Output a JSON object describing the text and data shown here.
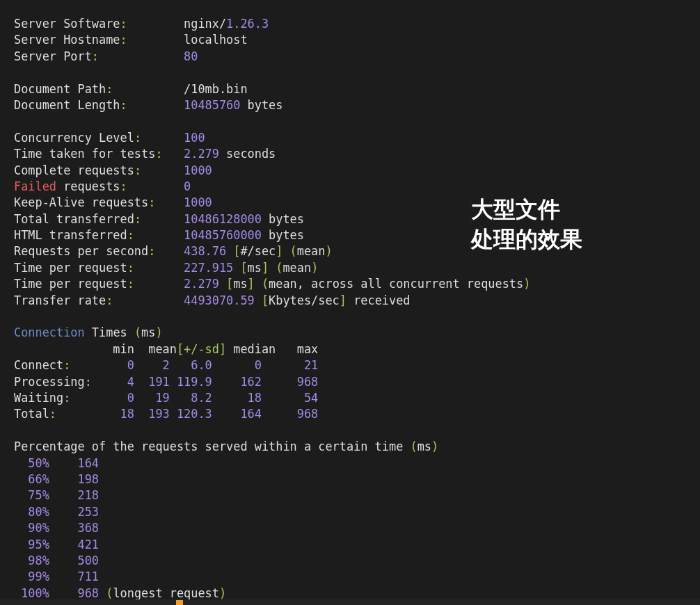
{
  "sections": [
    {
      "lines": [
        {
          "label": [
            {
              "text": "Server Software",
              "kind": "text"
            },
            {
              "text": ":",
              "kind": "punct"
            }
          ],
          "value": [
            {
              "text": "nginx/",
              "kind": "text"
            },
            {
              "text": "1.26.3",
              "kind": "number"
            }
          ]
        },
        {
          "label": [
            {
              "text": "Server Hostname",
              "kind": "text"
            },
            {
              "text": ":",
              "kind": "punct"
            }
          ],
          "value": [
            {
              "text": "localhost",
              "kind": "text"
            }
          ]
        },
        {
          "label": [
            {
              "text": "Server Port",
              "kind": "text"
            },
            {
              "text": ":",
              "kind": "punct"
            }
          ],
          "value": [
            {
              "text": "80",
              "kind": "number"
            }
          ]
        }
      ]
    },
    {
      "lines": [
        {
          "label": [
            {
              "text": "Document Path",
              "kind": "text"
            },
            {
              "text": ":",
              "kind": "punct"
            }
          ],
          "value": [
            {
              "text": "/10mb.bin",
              "kind": "text"
            }
          ]
        },
        {
          "label": [
            {
              "text": "Document Length",
              "kind": "text"
            },
            {
              "text": ":",
              "kind": "punct"
            }
          ],
          "value": [
            {
              "text": "10485760",
              "kind": "number"
            },
            {
              "text": " bytes",
              "kind": "text"
            }
          ]
        }
      ]
    },
    {
      "lines": [
        {
          "label": [
            {
              "text": "Concurrency Level",
              "kind": "text"
            },
            {
              "text": ":",
              "kind": "punct"
            }
          ],
          "value": [
            {
              "text": "100",
              "kind": "number"
            }
          ]
        },
        {
          "label": [
            {
              "text": "Time taken for tests",
              "kind": "text"
            },
            {
              "text": ":",
              "kind": "punct"
            }
          ],
          "value": [
            {
              "text": "2.279",
              "kind": "number"
            },
            {
              "text": " seconds",
              "kind": "text"
            }
          ]
        },
        {
          "label": [
            {
              "text": "Complete requests",
              "kind": "text"
            },
            {
              "text": ":",
              "kind": "punct"
            }
          ],
          "value": [
            {
              "text": "1000",
              "kind": "number"
            }
          ]
        },
        {
          "label": [
            {
              "text": "Failed",
              "kind": "error"
            },
            {
              "text": " requests",
              "kind": "text"
            },
            {
              "text": ":",
              "kind": "punct"
            }
          ],
          "value": [
            {
              "text": "0",
              "kind": "number"
            }
          ]
        },
        {
          "label": [
            {
              "text": "Keep-Alive requests",
              "kind": "text"
            },
            {
              "text": ":",
              "kind": "punct"
            }
          ],
          "value": [
            {
              "text": "1000",
              "kind": "number"
            }
          ]
        },
        {
          "label": [
            {
              "text": "Total transferred",
              "kind": "text"
            },
            {
              "text": ":",
              "kind": "punct"
            }
          ],
          "value": [
            {
              "text": "10486128000",
              "kind": "number"
            },
            {
              "text": " bytes",
              "kind": "text"
            }
          ]
        },
        {
          "label": [
            {
              "text": "HTML transferred",
              "kind": "text"
            },
            {
              "text": ":",
              "kind": "punct"
            }
          ],
          "value": [
            {
              "text": "10485760000",
              "kind": "number"
            },
            {
              "text": " bytes",
              "kind": "text"
            }
          ]
        },
        {
          "label": [
            {
              "text": "Requests per second",
              "kind": "text"
            },
            {
              "text": ":",
              "kind": "punct"
            }
          ],
          "value": [
            {
              "text": "438.76",
              "kind": "number"
            },
            {
              "text": " [",
              "kind": "punct"
            },
            {
              "text": "#/sec",
              "kind": "text"
            },
            {
              "text": "] (",
              "kind": "punct"
            },
            {
              "text": "mean",
              "kind": "text"
            },
            {
              "text": ")",
              "kind": "punct"
            }
          ]
        },
        {
          "label": [
            {
              "text": "Time per request",
              "kind": "text"
            },
            {
              "text": ":",
              "kind": "punct"
            }
          ],
          "value": [
            {
              "text": "227.915",
              "kind": "number"
            },
            {
              "text": " [",
              "kind": "punct"
            },
            {
              "text": "ms",
              "kind": "text"
            },
            {
              "text": "] (",
              "kind": "punct"
            },
            {
              "text": "mean",
              "kind": "text"
            },
            {
              "text": ")",
              "kind": "punct"
            }
          ]
        },
        {
          "label": [
            {
              "text": "Time per request",
              "kind": "text"
            },
            {
              "text": ":",
              "kind": "punct"
            }
          ],
          "value": [
            {
              "text": "2.279",
              "kind": "number"
            },
            {
              "text": " [",
              "kind": "punct"
            },
            {
              "text": "ms",
              "kind": "text"
            },
            {
              "text": "] (",
              "kind": "punct"
            },
            {
              "text": "mean, across all concurrent requests",
              "kind": "text"
            },
            {
              "text": ")",
              "kind": "punct"
            }
          ]
        },
        {
          "label": [
            {
              "text": "Transfer rate",
              "kind": "text"
            },
            {
              "text": ":",
              "kind": "punct"
            }
          ],
          "value": [
            {
              "text": "4493070.59",
              "kind": "number"
            },
            {
              "text": " [",
              "kind": "punct"
            },
            {
              "text": "Kbytes/sec",
              "kind": "text"
            },
            {
              "text": "]",
              "kind": "punct"
            },
            {
              "text": " received",
              "kind": "text"
            }
          ]
        }
      ]
    },
    {
      "lines": [
        {
          "segments": [
            {
              "text": "Connection",
              "kind": "heading"
            },
            {
              "text": " Times ",
              "kind": "text"
            },
            {
              "text": "(",
              "kind": "punct"
            },
            {
              "text": "ms",
              "kind": "text"
            },
            {
              "text": ")",
              "kind": "punct"
            }
          ]
        },
        {
          "segments": [
            {
              "text": "              min  mean",
              "kind": "text"
            },
            {
              "text": "[+/-sd]",
              "kind": "punct"
            },
            {
              "text": " median   max",
              "kind": "text"
            }
          ]
        },
        {
          "segments": [
            {
              "text": "Connect",
              "kind": "text"
            },
            {
              "text": ":",
              "kind": "punct"
            },
            {
              "text": "        0    2   6.0      0      21",
              "kind": "number"
            }
          ]
        },
        {
          "segments": [
            {
              "text": "Processing",
              "kind": "text"
            },
            {
              "text": ":",
              "kind": "punct"
            },
            {
              "text": "     4  191 119.9    162     968",
              "kind": "number"
            }
          ]
        },
        {
          "segments": [
            {
              "text": "Waiting",
              "kind": "text"
            },
            {
              "text": ":",
              "kind": "punct"
            },
            {
              "text": "        0   19   8.2     18      54",
              "kind": "number"
            }
          ]
        },
        {
          "segments": [
            {
              "text": "Total",
              "kind": "text"
            },
            {
              "text": ":",
              "kind": "punct"
            },
            {
              "text": "         18  193 120.3    164     968",
              "kind": "number"
            }
          ]
        }
      ]
    },
    {
      "lines": [
        {
          "segments": [
            {
              "text": "Percentage of the requests served within a certain time ",
              "kind": "text"
            },
            {
              "text": "(",
              "kind": "punct"
            },
            {
              "text": "ms",
              "kind": "text"
            },
            {
              "text": ")",
              "kind": "punct"
            }
          ]
        },
        {
          "segments": [
            {
              "text": "  50%    164",
              "kind": "number"
            }
          ]
        },
        {
          "segments": [
            {
              "text": "  66%    198",
              "kind": "number"
            }
          ]
        },
        {
          "segments": [
            {
              "text": "  75%    218",
              "kind": "number"
            }
          ]
        },
        {
          "segments": [
            {
              "text": "  80%    253",
              "kind": "number"
            }
          ]
        },
        {
          "segments": [
            {
              "text": "  90%    368",
              "kind": "number"
            }
          ]
        },
        {
          "segments": [
            {
              "text": "  95%    421",
              "kind": "number"
            }
          ]
        },
        {
          "segments": [
            {
              "text": "  98%    500",
              "kind": "number"
            }
          ]
        },
        {
          "segments": [
            {
              "text": "  99%    711",
              "kind": "number"
            }
          ]
        },
        {
          "segments": [
            {
              "text": " 100%    968 ",
              "kind": "number"
            },
            {
              "text": "(",
              "kind": "punct"
            },
            {
              "text": "longest request",
              "kind": "text"
            },
            {
              "text": ")",
              "kind": "punct"
            }
          ]
        }
      ]
    }
  ],
  "caption": [
    "大型文件",
    "处理的效果"
  ]
}
